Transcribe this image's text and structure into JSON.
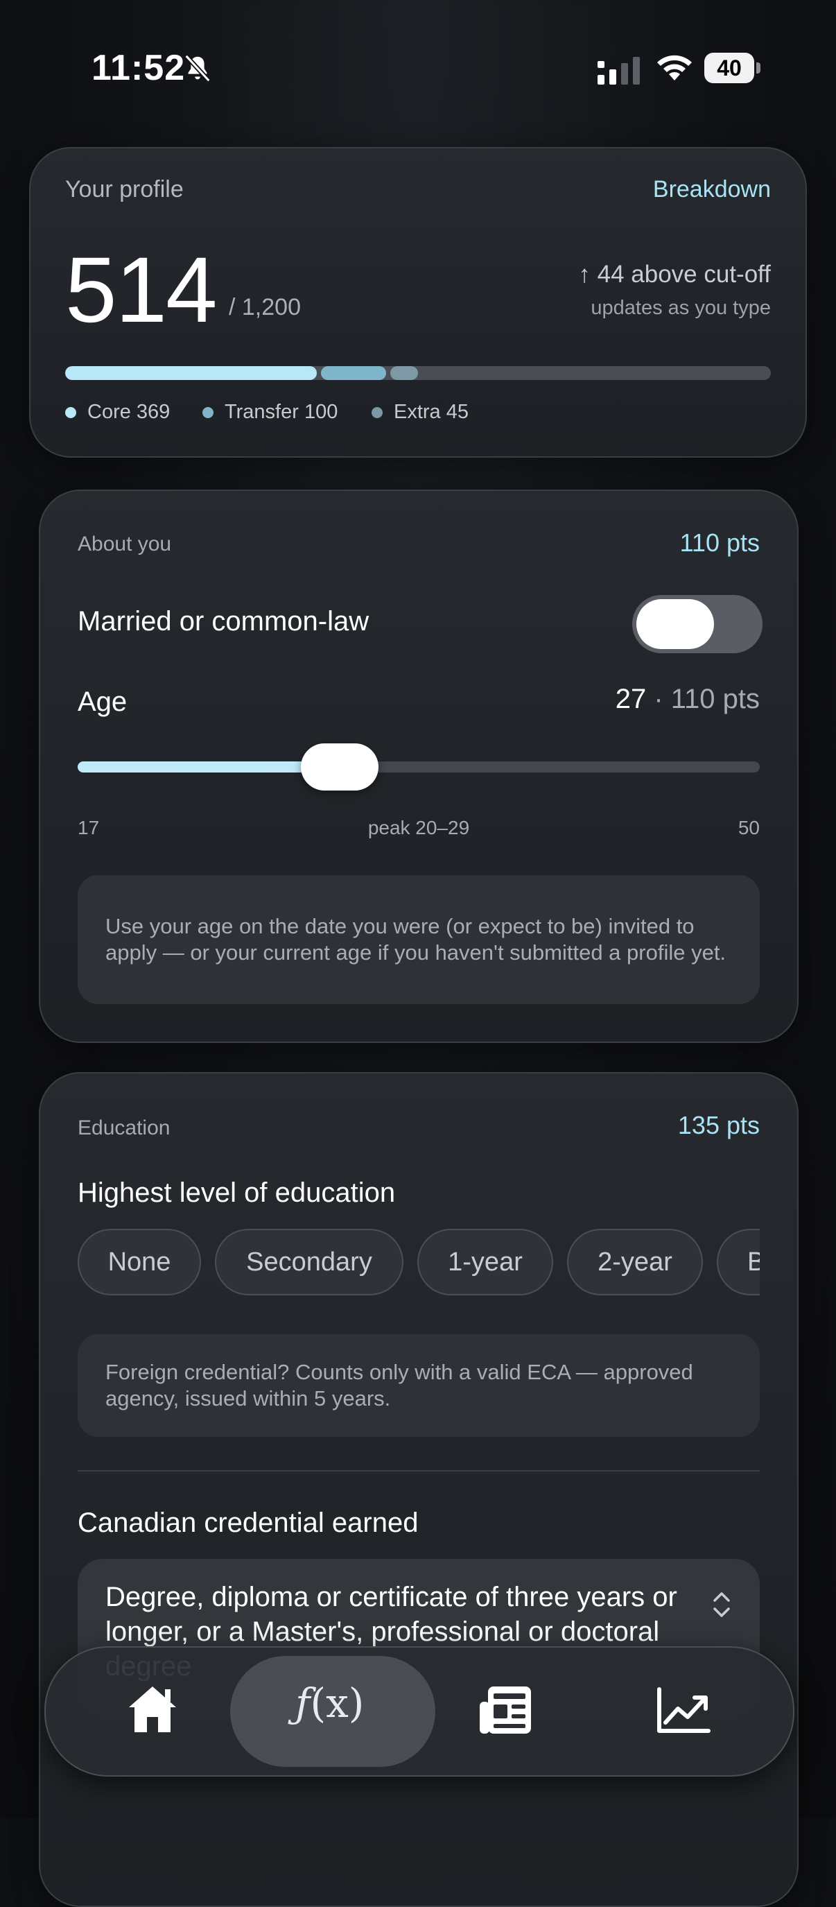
{
  "status_bar": {
    "time": "11:52",
    "battery": "40"
  },
  "profile": {
    "title": "Your profile",
    "breakdown_link": "Breakdown",
    "score": "514",
    "max": "/ 1,200",
    "above": "↑ 44 above cut-off",
    "updates": "updates as you type",
    "total_max": 1200,
    "segments": [
      {
        "label": "Core 369",
        "value": 369,
        "color": "#b8e8f7"
      },
      {
        "label": "Transfer 100",
        "value": 100,
        "color": "#7fb6cc"
      },
      {
        "label": "Extra 45",
        "value": 45,
        "color": "#7e98a6"
      }
    ]
  },
  "about": {
    "label": "About you",
    "points": "110 pts",
    "married_label": "Married or common-law",
    "married_on": false,
    "age_label": "Age",
    "age_value": "27",
    "age_points": " · 110 pts",
    "age_min": "17",
    "age_peak": "peak 20–29",
    "age_max": "50",
    "age_current": 27,
    "age_range": [
      17,
      50
    ],
    "note": "Use your age on the date you were (or expect to be) invited to apply — or your current age if you haven't submitted a profile yet."
  },
  "education": {
    "label": "Education",
    "points": "135 pts",
    "highest_label": "Highest level of education",
    "chips": [
      "None",
      "Secondary",
      "1-year",
      "2-year",
      "Bachelor's"
    ],
    "note": "Foreign credential? Counts only with a valid ECA — approved agency, issued within 5 years.",
    "canadian_label": "Canadian credential earned",
    "canadian_value": "Degree, diploma or certificate of three years or longer, or a Master's, professional or doctoral degree"
  },
  "nav": {
    "items": [
      "home",
      "calculator",
      "news",
      "trends"
    ],
    "active": "calculator",
    "fx_f": "ƒ",
    "fx_x": "(x)"
  }
}
